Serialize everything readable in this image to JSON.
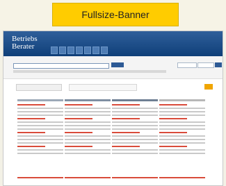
{
  "banner": {
    "label": "Fullsize-Banner",
    "color": "#ffcc00"
  },
  "site": {
    "logo_line1": "Betriebs",
    "logo_line2": "Berater"
  }
}
